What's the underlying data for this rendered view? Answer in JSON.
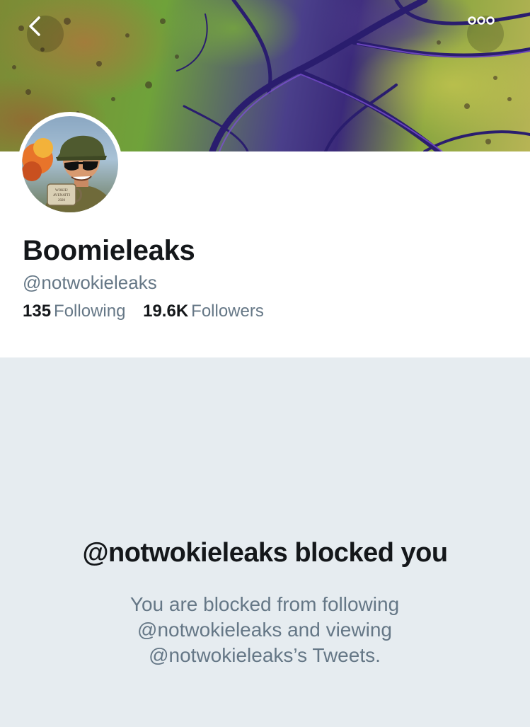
{
  "header": {
    "back_icon": "chevron-left-icon",
    "more_icon": "more-horizontal-icon"
  },
  "profile": {
    "display_name": "Boomieleaks",
    "handle": "@notwokieleaks",
    "avatar_mug_text": "WOKIE/ AVENATTI 2020",
    "following_count": "135",
    "following_label": "Following",
    "followers_count": "19.6K",
    "followers_label": "Followers"
  },
  "blocked": {
    "title": "@notwokieleaks blocked you",
    "message": "You are blocked from following @notwokieleaks and viewing @notwokieleaks’s Tweets."
  },
  "colors": {
    "text_primary": "#14171a",
    "text_secondary": "#657786",
    "page_background": "#e6ecf0"
  }
}
